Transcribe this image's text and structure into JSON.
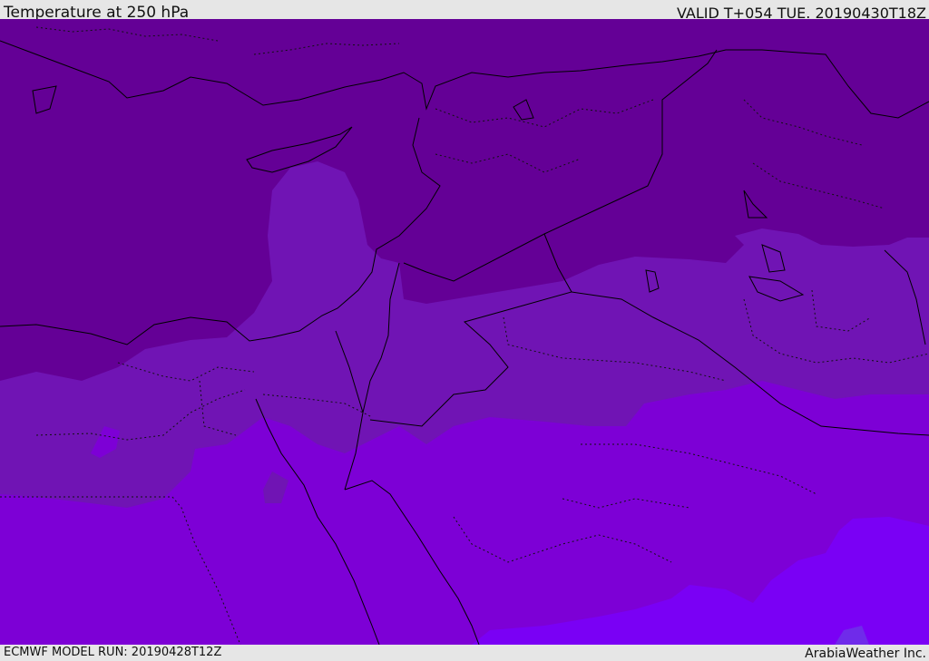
{
  "header": {
    "title": "Temperature at 250 hPa",
    "valid": "VALID T+054 TUE. 20190430T18Z"
  },
  "footer": {
    "model_run": "ECMWF MODEL RUN: 20190428T12Z",
    "credit": "ArabiaWeather Inc."
  },
  "colors": {
    "band_coldest": "#640096",
    "band_cold": "#7014b4",
    "band_mid": "#7d00d6",
    "band_warm": "#7a00f5",
    "band_warmest": "#6f2bea",
    "boundary": "#000000"
  }
}
